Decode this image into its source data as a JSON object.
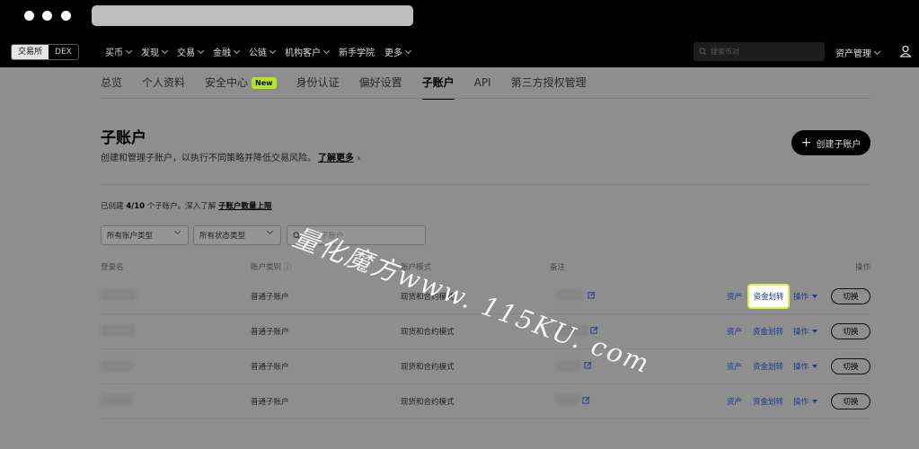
{
  "browser": {
    "url": ""
  },
  "topnav": {
    "segment": [
      "交易所",
      "DEX"
    ],
    "menu": [
      "买币",
      "发现",
      "交易",
      "金融",
      "公链",
      "机构客户",
      "新手学院",
      "更多"
    ],
    "search_placeholder": "搜索币对",
    "asset_mgmt": "资产管理"
  },
  "tabs": [
    {
      "label": "总览"
    },
    {
      "label": "个人资料"
    },
    {
      "label": "安全中心",
      "badge": "New"
    },
    {
      "label": "身份认证"
    },
    {
      "label": "偏好设置"
    },
    {
      "label": "子账户"
    },
    {
      "label": "API"
    },
    {
      "label": "第三方授权管理"
    }
  ],
  "page": {
    "title": "子账户",
    "desc": "创建和管理子账户，以执行不同策略并降低交易风险。",
    "learn_more": "了解更多",
    "create_button": "创建子账户",
    "stat_prefix": "已创建",
    "stat_count": "4/10",
    "stat_mid": "个子账户。深入了解",
    "stat_link": "子账户数量上限"
  },
  "filters": {
    "account_type": "所有账户类型",
    "status_type": "所有状态类型",
    "search_placeholder": "搜索子账户"
  },
  "table": {
    "headers": [
      "登录名",
      "账户类别 ⓘ",
      "账户模式",
      "备注",
      "操作"
    ],
    "rows": [
      {
        "type": "普通子账户",
        "mode": "现货和合约模式",
        "asset": "资产",
        "transfer": "资金划转",
        "ops": "操作",
        "switch": "切换"
      },
      {
        "type": "普通子账户",
        "mode": "现货和合约模式",
        "asset": "资产",
        "transfer": "资金划转",
        "ops": "操作",
        "switch": "切换"
      },
      {
        "type": "普通子账户",
        "mode": "现货和合约模式",
        "asset": "资产",
        "transfer": "资金划转",
        "ops": "操作",
        "switch": "切换"
      },
      {
        "type": "普通子账户",
        "mode": "现货和合约模式",
        "asset": "资产",
        "transfer": "资金划转",
        "ops": "操作",
        "switch": "切换"
      }
    ]
  },
  "watermark": "量化魔方www. 115KU. com",
  "colors": {
    "accent": "#b6e61f",
    "highlight_border": "#d8ef45",
    "link": "#1d3a8a"
  }
}
